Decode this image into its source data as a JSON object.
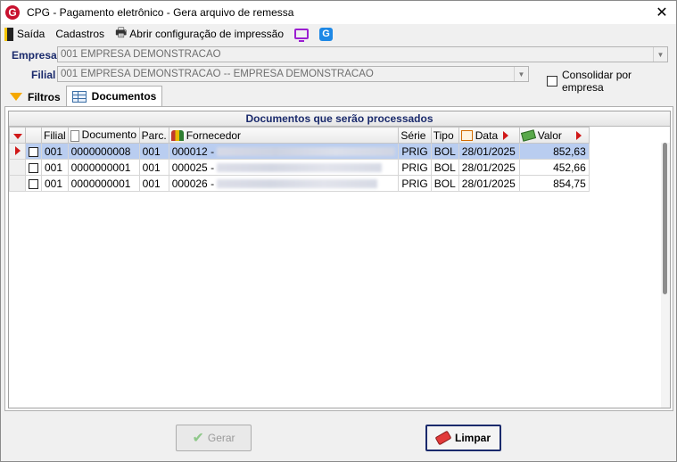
{
  "window": {
    "title": "CPG -  Pagamento eletrônico - Gera arquivo de remessa",
    "logo_letter": "G",
    "close_glyph": "✕"
  },
  "toolbar": {
    "exit_label": "Saída",
    "cadastros_label": "Cadastros",
    "print_config_label": "Abrir configuração de impressão",
    "g_letter": "G"
  },
  "filters": {
    "empresa_label": "Empresa",
    "empresa_value": "001 EMPRESA DEMONSTRACAO",
    "filial_label": "Filial",
    "filial_value": "001 EMPRESA DEMONSTRACAO -- EMPRESA DEMONSTRACAO",
    "consolidar_label": "Consolidar por empresa",
    "consolidar_checked": false
  },
  "tabs": [
    {
      "label": "Filtros",
      "active": false
    },
    {
      "label": "Documentos",
      "active": true
    }
  ],
  "grid": {
    "caption": "Documentos que serão processados",
    "columns": {
      "filial": "Filial",
      "documento": "Documento",
      "parc": "Parc.",
      "fornecedor": "Fornecedor",
      "serie": "Série",
      "tipo": "Tipo",
      "data": "Data",
      "valor": "Valor"
    },
    "rows": [
      {
        "selected": true,
        "checked": false,
        "filial": "001",
        "documento": "0000000008",
        "parc": "001",
        "fornecedor": "000012 -",
        "serie": "PRIG",
        "tipo": "BOL",
        "data": "28/01/2025",
        "valor": "852,63"
      },
      {
        "selected": false,
        "checked": false,
        "filial": "001",
        "documento": "0000000001",
        "parc": "001",
        "fornecedor": "000025 -",
        "serie": "PRIG",
        "tipo": "BOL",
        "data": "28/01/2025",
        "valor": "452,66"
      },
      {
        "selected": false,
        "checked": false,
        "filial": "001",
        "documento": "0000000001",
        "parc": "001",
        "fornecedor": "000026 -",
        "serie": "PRIG",
        "tipo": "BOL",
        "data": "28/01/2025",
        "valor": "854,75"
      }
    ]
  },
  "buttons": {
    "gerar_label": "Gerar",
    "gerar_enabled": false,
    "limpar_label": "Limpar"
  },
  "colors": {
    "accent_label": "#1a2a6c",
    "selection": "#b9cdf0",
    "indicator": "#d01818"
  }
}
